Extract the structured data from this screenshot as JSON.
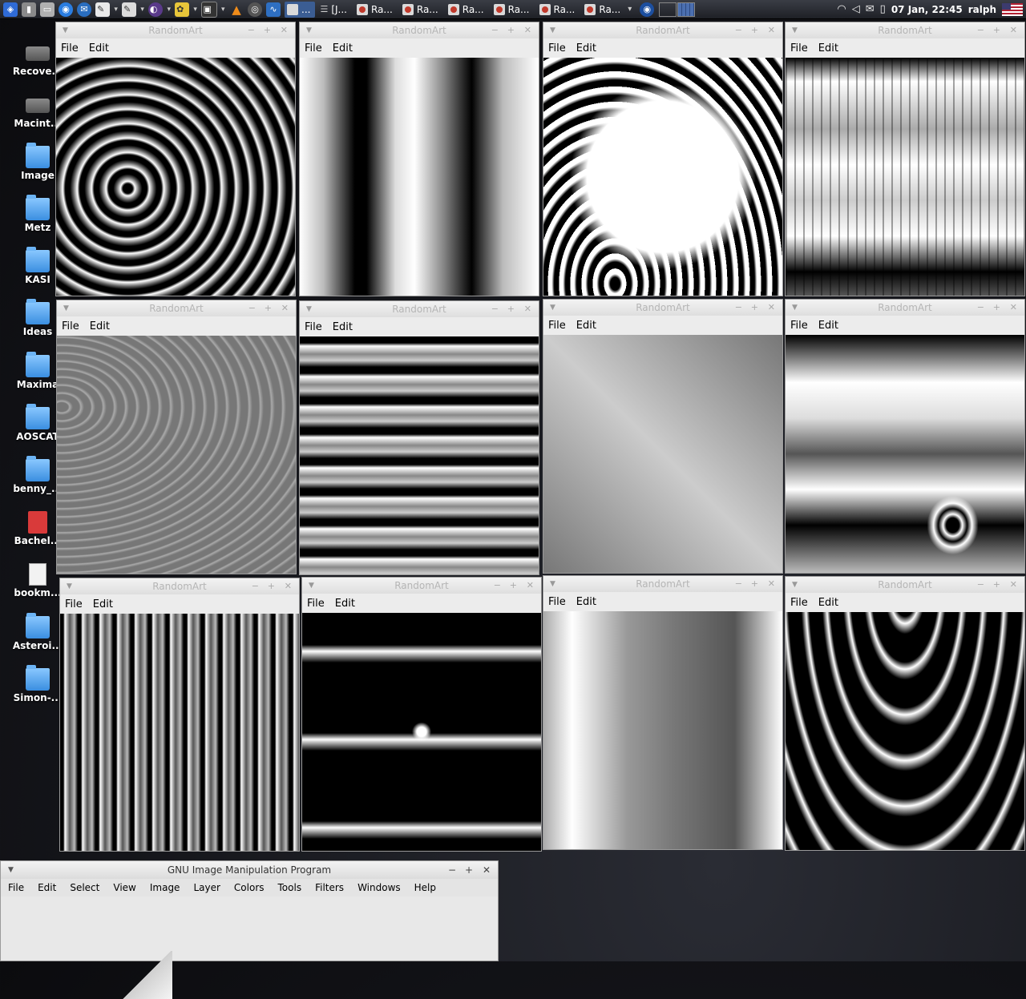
{
  "taskbar": {
    "tasks": [
      {
        "label": "...",
        "active": true
      },
      {
        "label": "[J...",
        "active": false
      },
      {
        "label": "Ra...",
        "active": false
      },
      {
        "label": "Ra...",
        "active": false
      },
      {
        "label": "Ra...",
        "active": false
      },
      {
        "label": "Ra...",
        "active": false
      },
      {
        "label": "Ra...",
        "active": false
      },
      {
        "label": "Ra...",
        "active": false
      }
    ],
    "clock": "07 Jan, 22:45",
    "user": "ralph"
  },
  "desktop_icons": [
    {
      "label": "Recove...",
      "kind": "drive"
    },
    {
      "label": "Macint...",
      "kind": "drive"
    },
    {
      "label": "Image",
      "kind": "folder"
    },
    {
      "label": "Metz",
      "kind": "folder"
    },
    {
      "label": "KASI",
      "kind": "folder"
    },
    {
      "label": "Ideas",
      "kind": "folder"
    },
    {
      "label": "Maxima",
      "kind": "folder"
    },
    {
      "label": "AOSCAT",
      "kind": "folder"
    },
    {
      "label": "benny_...",
      "kind": "folder"
    },
    {
      "label": "Bachel...",
      "kind": "pdf"
    },
    {
      "label": "bookm...",
      "kind": "doc"
    },
    {
      "label": "Asteroi...",
      "kind": "folder"
    },
    {
      "label": "Simon-...",
      "kind": "folder"
    }
  ],
  "randomart": {
    "title": "RandomArt",
    "menu_file": "File",
    "menu_edit": "Edit"
  },
  "gimp": {
    "title": "GNU Image Manipulation Program",
    "menu": [
      "File",
      "Edit",
      "Select",
      "View",
      "Image",
      "Layer",
      "Colors",
      "Tools",
      "Filters",
      "Windows",
      "Help"
    ]
  }
}
